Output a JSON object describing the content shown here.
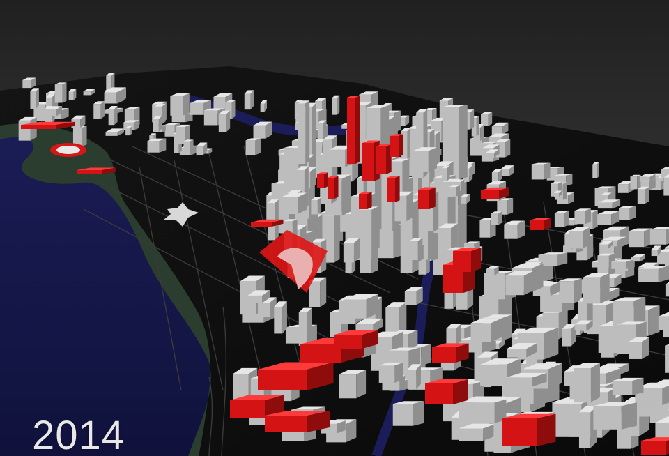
{
  "overlay": {
    "year": "2014"
  },
  "colors": {
    "sky": "#262626",
    "ground": "#111111",
    "water": "#14164a",
    "park": "#2b3d2e",
    "building": "#cfcfcf",
    "highlight": "#e01515"
  },
  "legend_meaning": {
    "highlighted_buildings": "red",
    "other_buildings": "grey"
  }
}
